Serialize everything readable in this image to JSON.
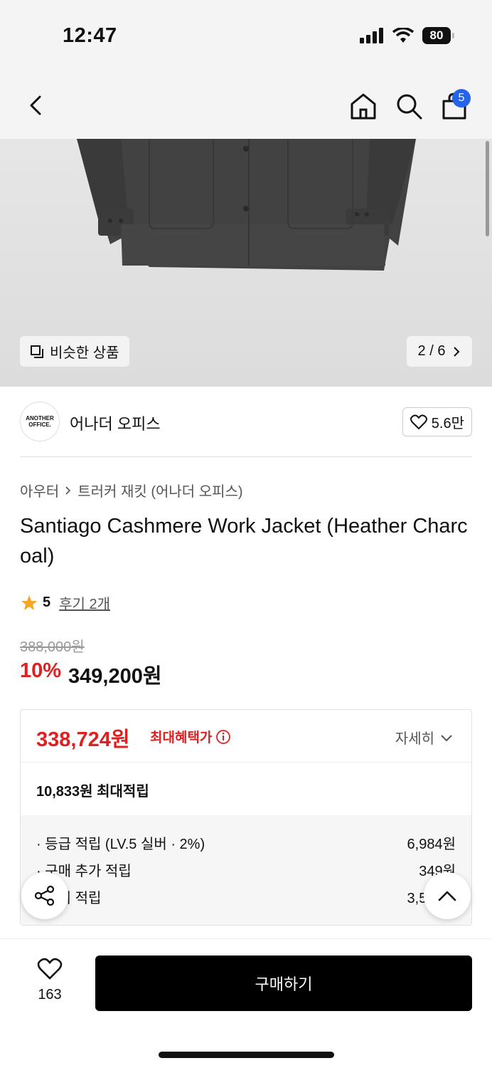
{
  "status": {
    "time": "12:47",
    "battery": "80"
  },
  "nav": {
    "cart_count": "5"
  },
  "gallery": {
    "similar_label": "비슷한 상품",
    "page_indicator": "2 / 6"
  },
  "brand": {
    "logo_line1": "ANOTHER",
    "logo_line2": "OFFICE.",
    "name": "어나더 오피스",
    "likes": "5.6만"
  },
  "breadcrumb": {
    "category": "아우터",
    "subcategory": "트러커 재킷 (어나더 오피스)"
  },
  "product": {
    "title": "Santiago Cashmere Work Jacket (Heather Charcoal)",
    "rating": "5",
    "reviews": "후기 2개",
    "original_price": "388,000원",
    "discount": "10%",
    "sale_price": "349,200원"
  },
  "benefit": {
    "max_price": "338,724원",
    "max_label": "최대혜택가",
    "detail_toggle": "자세히",
    "points_total": "10,833원 최대적립",
    "points": [
      {
        "label": "· 등급 적립 (LV.5 실버 · 2%)",
        "value": "6,984원"
      },
      {
        "label": "· 구매 추가 적립",
        "value": "349원"
      },
      {
        "label": "· 후기 적립",
        "value": "3,500원"
      }
    ]
  },
  "bottom": {
    "wish_count": "163",
    "buy_label": "구매하기"
  },
  "colors": {
    "accent_red": "#e02020",
    "badge_blue": "#2563eb",
    "buy_black": "#000000"
  }
}
